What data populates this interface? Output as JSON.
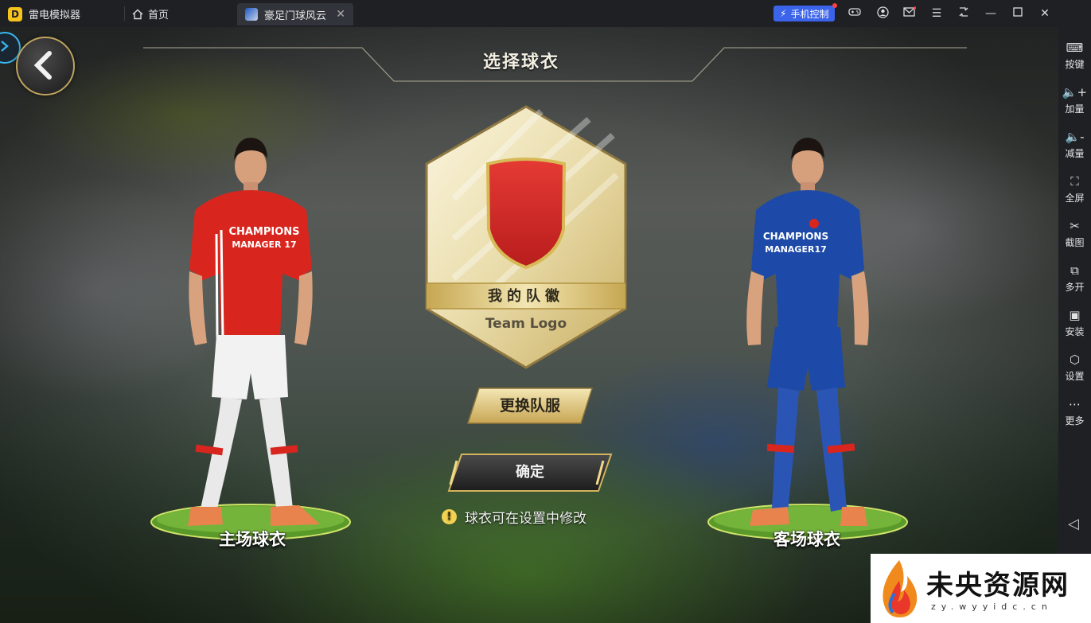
{
  "emulator": {
    "app_name": "雷电模拟器",
    "tabs": [
      {
        "label": "首页",
        "icon": "home-icon"
      },
      {
        "label": "豪足门球风云",
        "icon": "game-icon"
      }
    ],
    "phone_control_label": "手机控制",
    "title_icons": [
      "gamepad-icon",
      "user-icon",
      "mail-icon",
      "menu-icon",
      "restore-icon",
      "minimize-icon",
      "maximize-icon",
      "close-icon"
    ]
  },
  "sidebar": {
    "items": [
      {
        "label": "按键",
        "icon": "keyboard-icon"
      },
      {
        "label": "加量",
        "icon": "volume-up-icon"
      },
      {
        "label": "减量",
        "icon": "volume-down-icon"
      },
      {
        "label": "全屏",
        "icon": "fullscreen-icon"
      },
      {
        "label": "截图",
        "icon": "scissors-icon"
      },
      {
        "label": "多开",
        "icon": "multi-instance-icon"
      },
      {
        "label": "安装",
        "icon": "apk-install-icon"
      },
      {
        "label": "设置",
        "icon": "settings-icon"
      },
      {
        "label": "更多",
        "icon": "more-icon"
      }
    ]
  },
  "game": {
    "title": "选择球衣",
    "badge": {
      "label_cn": "我的队徽",
      "label_en": "Team Logo",
      "shield_color": "#d92a2a"
    },
    "change_kit_button": "更换队服",
    "confirm_button": "确定",
    "hint": "球衣可在设置中修改",
    "home_kit": {
      "label": "主场球衣",
      "shirt_text_1": "CHAMPIONS",
      "shirt_text_2": "MANAGER 17",
      "shirt_color": "#d8261f",
      "shorts_color": "#f2f2f2"
    },
    "away_kit": {
      "label": "客场球衣",
      "shirt_text_1": "CHAMPIONS",
      "shirt_text_2": "MANAGER17",
      "shirt_color": "#1d4aa8",
      "shorts_color": "#1d4aa8"
    }
  },
  "watermark": {
    "title": "未央资源网",
    "url": "zy.wyyidc.cn"
  }
}
